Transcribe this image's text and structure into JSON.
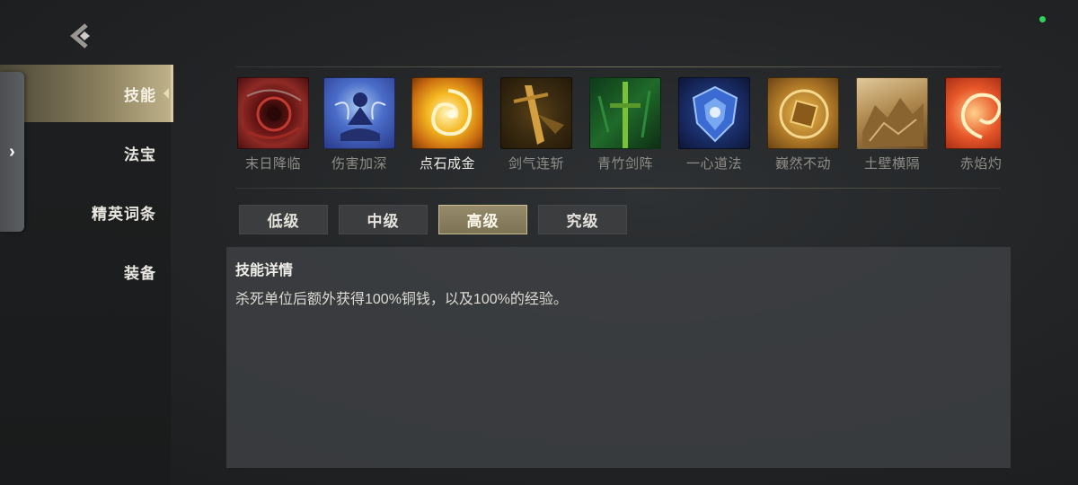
{
  "nav": {
    "back_icon": "back-chevron-icon",
    "status_color": "#2fd45a"
  },
  "sidebar": {
    "drawer_icon": "chevron-right-icon",
    "drawer_glyph": "›",
    "tabs": [
      {
        "label": "技能",
        "active": true
      },
      {
        "label": "法宝",
        "active": false
      },
      {
        "label": "精英词条",
        "active": false
      },
      {
        "label": "装备",
        "active": false
      }
    ]
  },
  "skills": [
    {
      "name": "末日降临",
      "selected": false,
      "icon": "crimson-vortex-icon"
    },
    {
      "name": "伤害加深",
      "selected": false,
      "icon": "meditating-figure-icon"
    },
    {
      "name": "点石成金",
      "selected": true,
      "icon": "golden-swirl-icon"
    },
    {
      "name": "剑气连斩",
      "selected": false,
      "icon": "golden-sword-icon"
    },
    {
      "name": "青竹剑阵",
      "selected": false,
      "icon": "bamboo-sword-icon"
    },
    {
      "name": "一心道法",
      "selected": false,
      "icon": "blue-shield-icon"
    },
    {
      "name": "巍然不动",
      "selected": false,
      "icon": "bronze-shield-icon"
    },
    {
      "name": "土壁横隔",
      "selected": false,
      "icon": "earth-wall-icon"
    },
    {
      "name": "赤焰灼",
      "selected": false,
      "icon": "fire-spiral-icon"
    }
  ],
  "levels": [
    {
      "label": "低级",
      "active": false
    },
    {
      "label": "中级",
      "active": false
    },
    {
      "label": "高级",
      "active": true
    },
    {
      "label": "究级",
      "active": false
    }
  ],
  "details": {
    "title": "技能详情",
    "text": "杀死单位后额外获得100%铜钱，以及100%的经验。"
  }
}
